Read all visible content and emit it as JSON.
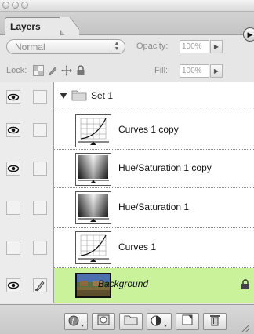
{
  "palette": {
    "title": "Layers",
    "blend_mode": "Normal",
    "opacity_label": "Opacity:",
    "opacity_value": "100%",
    "lock_label": "Lock:",
    "fill_label": "Fill:",
    "fill_value": "100%"
  },
  "layers": [
    {
      "name": "Set 1",
      "type": "group",
      "visible": true,
      "expanded": true
    },
    {
      "name": "Curves 1 copy",
      "type": "curves-adjustment",
      "visible": true
    },
    {
      "name": "Hue/Saturation 1 copy",
      "type": "hue-saturation-adjustment",
      "visible": true
    },
    {
      "name": "Hue/Saturation 1",
      "type": "hue-saturation-adjustment",
      "visible": false
    },
    {
      "name": "Curves 1",
      "type": "curves-adjustment",
      "visible": false
    },
    {
      "name": "Background",
      "type": "image",
      "visible": true,
      "selected": true,
      "locked": true
    }
  ],
  "colors": {
    "selected_layer": "#c9f29b",
    "panel_bg": "#e6e6e6"
  },
  "bottom_icons": [
    "layer-style-icon",
    "layer-mask-icon",
    "new-set-icon",
    "new-adjustment-layer-icon",
    "new-layer-icon",
    "trash-icon"
  ]
}
